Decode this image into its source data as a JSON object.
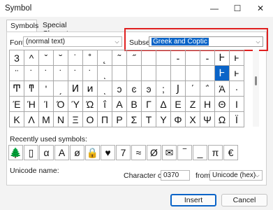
{
  "window": {
    "title": "Symbol"
  },
  "tabs": [
    {
      "label": "Symbols"
    },
    {
      "label": "Special Characters"
    }
  ],
  "font": {
    "label": "Font:",
    "value": "(normal text)"
  },
  "subset": {
    "label": "Subset:",
    "value": "Greek and Coptic"
  },
  "grid_rows": [
    [
      "3",
      "^",
      "ˇ",
      "˘",
      "˙",
      "˚",
      "˛",
      "˜",
      "˝",
      "",
      "",
      "-",
      "",
      "-",
      "Ͱ",
      "ͱ"
    ],
    [
      "¨",
      "˙",
      "˙",
      "˙",
      "˙",
      "˙",
      "ͺ",
      "",
      "",
      "",
      "",
      "",
      "",
      "",
      "Ͱ",
      "ͱ"
    ],
    [
      "Ͳ",
      "ͳ",
      "ʹ",
      "͵",
      "Ͷ",
      "ͷ",
      "ͺ",
      "ͻ",
      "ͼ",
      "ͽ",
      ";",
      "Ϳ",
      "΄",
      "΅",
      "Ά",
      "·"
    ],
    [
      "Έ",
      "Ή",
      "Ί",
      "Ό",
      "Ύ",
      "Ώ",
      "ΐ",
      "Α",
      "Β",
      "Γ",
      "Δ",
      "Ε",
      "Ζ",
      "Η",
      "Θ",
      "Ι"
    ],
    [
      "Κ",
      "Λ",
      "Μ",
      "Ν",
      "Ξ",
      "Ο",
      "Π",
      "Ρ",
      "Σ",
      "Τ",
      "Υ",
      "Φ",
      "Χ",
      "Ψ",
      "Ω",
      "Ϊ"
    ]
  ],
  "recent": {
    "label": "Recently used symbols:",
    "items": [
      "🌲",
      "▯",
      "α",
      "A",
      "ø",
      "🔒",
      "♥",
      "7",
      "≈",
      "Ø",
      "✉",
      "‾",
      "_",
      "π",
      "€"
    ]
  },
  "unicode_name_label": "Unicode name:",
  "char_code": {
    "label": "Character code:",
    "value": "0370"
  },
  "from": {
    "label": "from:",
    "value": "Unicode (hex)"
  },
  "buttons": {
    "insert": "Insert",
    "cancel": "Cancel"
  }
}
